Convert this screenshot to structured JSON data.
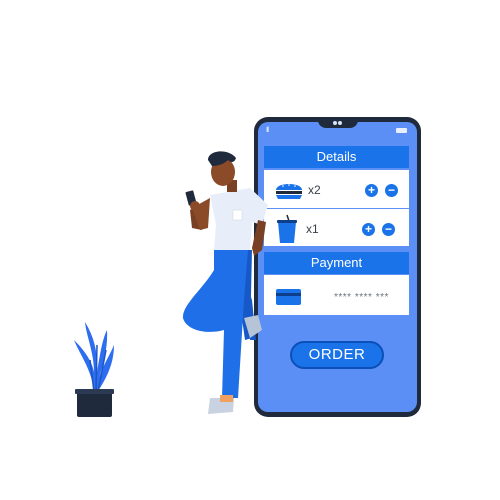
{
  "phone": {
    "status_signal": "Ill",
    "details_title": "Details",
    "items": [
      {
        "icon": "burger-icon",
        "quantity": "x2",
        "plus": "+",
        "minus": "−"
      },
      {
        "icon": "drink-cup-icon",
        "quantity": "x1",
        "plus": "+",
        "minus": "−"
      }
    ],
    "payment_title": "Payment",
    "card_number_masked": "**** **** ***",
    "order_button": "ORDER"
  },
  "colors": {
    "accent": "#1a73e8",
    "screen": "#5b8ff5",
    "phone_frame": "#1f2a3c",
    "plant": "#2d6ef0",
    "shirt": "#e8eef9",
    "pants": "#1f6fe8"
  }
}
